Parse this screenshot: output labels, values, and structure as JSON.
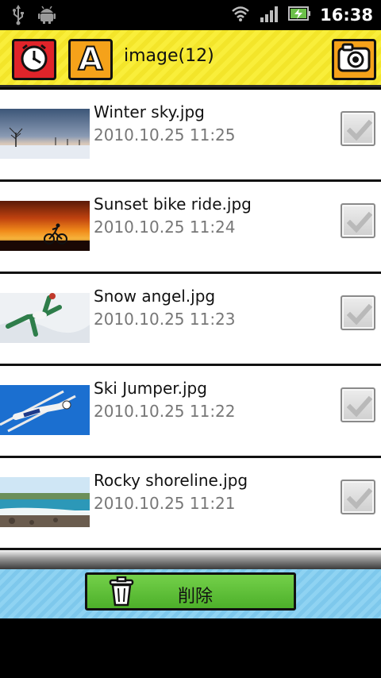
{
  "status_bar": {
    "time": "16:38",
    "left_icons": [
      "usb-icon",
      "android-icon"
    ],
    "right_icons": [
      "wifi-icon",
      "signal-icon",
      "battery-charging-icon"
    ]
  },
  "header": {
    "title": "image(12)",
    "clock_button_icon": "clock-icon",
    "letter_button_label": "A",
    "camera_button_icon": "camera-icon",
    "colors": {
      "background": "#f9ee3a",
      "clock_button": "#e0242a",
      "letter_button": "#f5a21a",
      "camera_button": "#f5a21a"
    }
  },
  "items": [
    {
      "title": "Winter sky.jpg",
      "date": "2010.10.25 11:25",
      "checked": true,
      "thumbnail": "winter-sky-thumbnail"
    },
    {
      "title": "Sunset bike ride.jpg",
      "date": "2010.10.25 11:24",
      "checked": true,
      "thumbnail": "sunset-bike-thumbnail"
    },
    {
      "title": "Snow angel.jpg",
      "date": "2010.10.25 11:23",
      "checked": true,
      "thumbnail": "snow-angel-thumbnail"
    },
    {
      "title": "Ski Jumper.jpg",
      "date": "2010.10.25 11:22",
      "checked": true,
      "thumbnail": "ski-jumper-thumbnail"
    },
    {
      "title": "Rocky shoreline.jpg",
      "date": "2010.10.25 11:21",
      "checked": true,
      "thumbnail": "rocky-shoreline-thumbnail"
    }
  ],
  "footer": {
    "delete_label": "削除",
    "delete_icon": "trash-icon",
    "colors": {
      "background": "#8fd3f2",
      "button": "#5cbf36"
    }
  }
}
